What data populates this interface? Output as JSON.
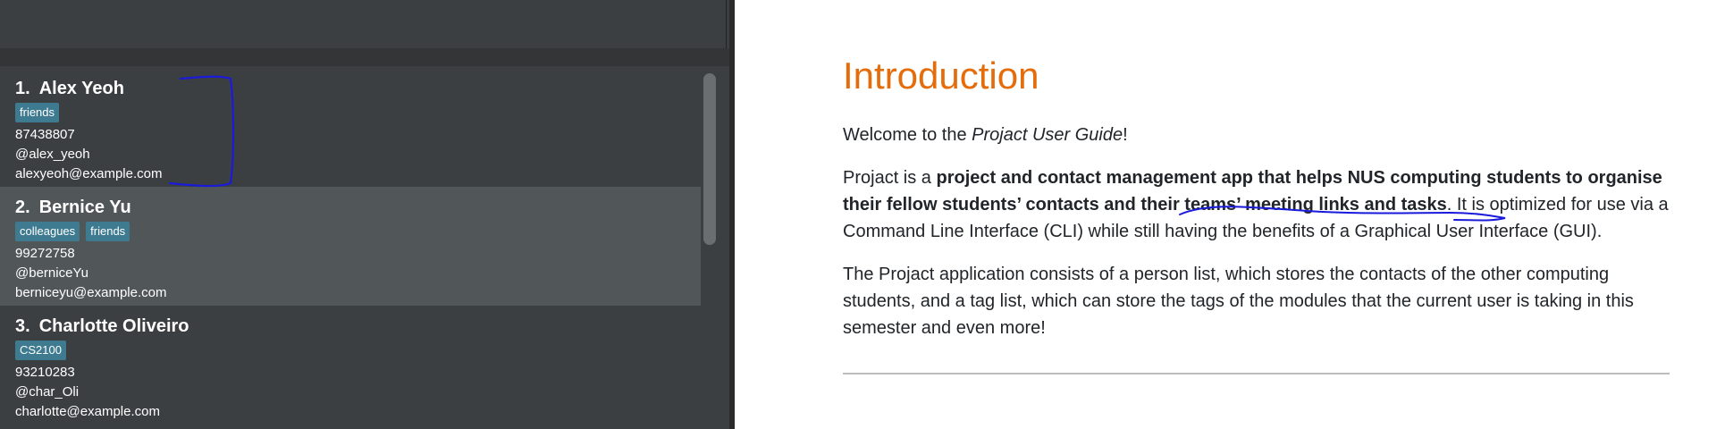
{
  "persons": [
    {
      "index": "1.",
      "name": "Alex Yeoh",
      "tags": [
        "friends"
      ],
      "phone": "87438807",
      "telegram": "@alex_yeoh",
      "email": "alexyeoh@example.com"
    },
    {
      "index": "2.",
      "name": "Bernice Yu",
      "tags": [
        "colleagues",
        "friends"
      ],
      "phone": "99272758",
      "telegram": "@berniceYu",
      "email": "berniceyu@example.com"
    },
    {
      "index": "3.",
      "name": "Charlotte Oliveiro",
      "tags": [
        "CS2100"
      ],
      "phone": "93210283",
      "telegram": "@char_Oli",
      "email": "charlotte@example.com"
    }
  ],
  "guide": {
    "title": "Introduction",
    "welcome_pre": "Welcome to the ",
    "welcome_em": "Projact User Guide",
    "welcome_post": "!",
    "p2_pre": "Projact is a ",
    "p2_bold1": "project and contact management app that helps NUS computing students to organise their fellow students’ contacts and their ",
    "p2_bold2": "teams’ meeting links and tasks",
    "p2_post": ". It is optimized for use via a Command Line Interface (CLI) while still having the benefits of a Graphical User Interface (GUI).",
    "p3": "The Projact application consists of a person list, which stores the contacts of the other computing students, and a tag list, which can store the tags of the modules that the current user is taking in this semester and even more!"
  },
  "colors": {
    "tag_bg": "#3e7b91",
    "heading": "#e46c0a",
    "annotation_ink": "#1a1adb"
  }
}
